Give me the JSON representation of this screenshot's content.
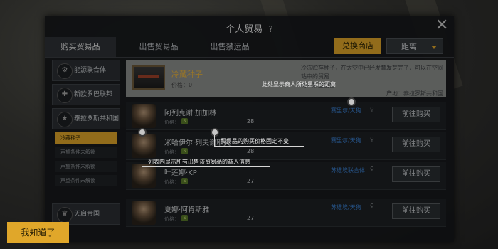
{
  "window": {
    "title": "个人贸易",
    "help": "?"
  },
  "tabs": [
    {
      "label": "购买贸易品",
      "active": true
    },
    {
      "label": "出售贸易品",
      "active": false
    },
    {
      "label": "出售禁运品",
      "active": false
    }
  ],
  "toolbar": {
    "exchange_label": "兑换商店",
    "sort_label": "距离"
  },
  "sidebar": {
    "categories": [
      {
        "label": "能源联合体",
        "icon": "factory-icon"
      },
      {
        "label": "新欧罗巴联邦",
        "icon": "star-icon"
      },
      {
        "label": "泰拉罗斯共和国",
        "icon": "star-icon"
      },
      {
        "label": "天启帝国",
        "icon": "crown-icon"
      }
    ],
    "subitems": [
      {
        "label": "冷藏种子",
        "active": true
      },
      {
        "label": "声望条件未解锁",
        "active": false
      },
      {
        "label": "声望条件未解锁",
        "active": false
      },
      {
        "label": "声望条件未解锁",
        "active": false
      }
    ]
  },
  "item": {
    "name": "冷藏种子",
    "price_label": "价格：0",
    "description_line1": "冷冻贮存种子，在太空中已经发育发芽完了，可以在空间站中的贸易",
    "description_line2": "商人那里出售",
    "description_source": "产地：泰拉罗斯共和国"
  },
  "merchants": [
    {
      "name": "阿列克谢·加加林",
      "price_label": "价格：",
      "coin": "S",
      "price": "28",
      "location": "赛里尔/天狗",
      "buy_label": "前往购买"
    },
    {
      "name": "米哈伊尔·列夫谢耶夫",
      "price_label": "价格：",
      "coin": "S",
      "price": "28",
      "location": "赛里尔/天狗",
      "buy_label": "前往购买"
    },
    {
      "name": "叶莲娜·KP",
      "price_label": "价格：",
      "coin": "S",
      "price": "27",
      "location": "苏维埃联合体",
      "buy_label": "前往购买"
    },
    {
      "name": "夏娜·阿肯斯雅",
      "price_label": "价格：",
      "coin": "S",
      "price": "27",
      "location": "苏维埃/天狗",
      "buy_label": "前往购买"
    }
  ],
  "callouts": {
    "distance": "此处显示商人所处星系的距离",
    "fixed_price": "贸易品的购买价格固定不变",
    "merchant_info": "列表内显示所有出售该贸易品的商人信息"
  },
  "confirm": {
    "label": "我知道了"
  },
  "colors": {
    "accent": "#e0a72a",
    "location_link": "#3a7fd0"
  }
}
